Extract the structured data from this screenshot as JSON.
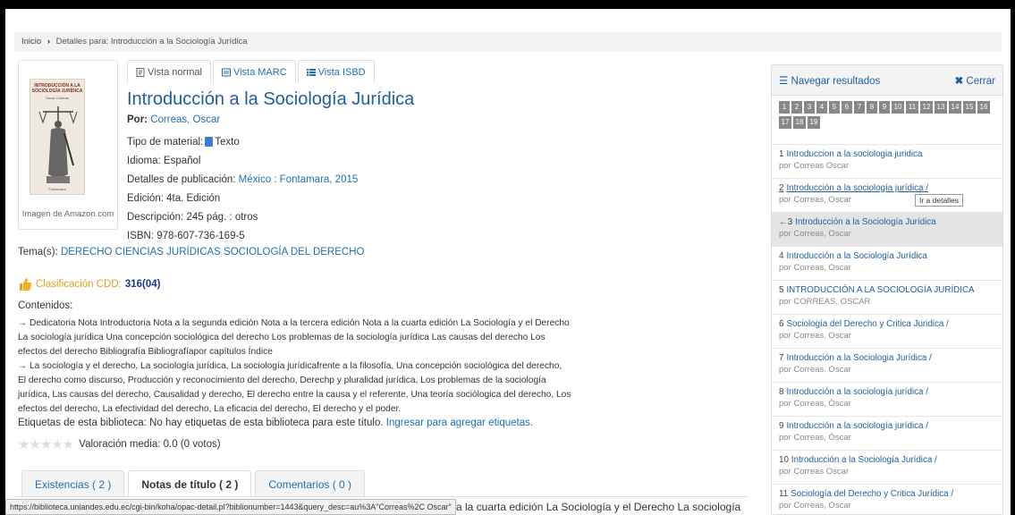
{
  "breadcrumb": {
    "home": "Inicio",
    "current": "Detalles para: Introducción a la Sociología Jurídica"
  },
  "cover": {
    "book_title": "INTRODUCCIÓN A LA SOCIOLOGÍA JURÍDICA",
    "book_author": "Óscar Correas",
    "publisher": "Fontamara",
    "caption": "Imagen de Amazon.com"
  },
  "view_tabs": [
    {
      "label": "Vista normal",
      "icon": "document-icon"
    },
    {
      "label": "Vista MARC",
      "icon": "list-box-icon"
    },
    {
      "label": "Vista ISBD",
      "icon": "list-icon"
    }
  ],
  "record": {
    "title": "Introducción a la Sociología Jurídica",
    "by_label": "Por:",
    "author": "Correas, Oscar",
    "material_label": "Tipo de material:",
    "material_value": "Texto",
    "language": "Idioma: Español",
    "pub_label": "Detalles de publicación:",
    "pub_value": "México : Fontamara, 2015",
    "edition": "Edición: 4ta. Edición",
    "description": "Descripción: 245 pág. : otros",
    "isbn": "ISBN: 978-607-736-169-5"
  },
  "subject": {
    "label": "Tema(s):",
    "value": "DERECHO CIENCIAS JURÍDICAS SOCIOLOGÍA DEL DERECHO"
  },
  "cdd": {
    "label": "Clasificación CDD:",
    "value": "316(04)"
  },
  "contents": {
    "label": "Contenidos:",
    "p1": "→ Dedicatoria Nota Introductoria Nota a la segunda edición Nota a la tercera edición Nota a la cuarta edición La Sociología y el Derecho La sociología jurídica Una concepción sociológica del derecho Los problemas de la sociología jurídica Las causas del derecho Los efectos del derecho Bibliografía Bibliografíapor capítulos Índice",
    "p2": "→ La sociología y el derecho, La sociología jurídica, La sociología jurídicafrente a la filosofía, Una concepción sociológica del derecho, El derecho como discurso, Producción y reconocimiento del derecho, Derechp y pluralidad jurídica, Los problemas de la sociología jurídica, Las causas del derecho, Causalidad y derecho, El derecho entre la causa y el referente, Una teoría sociólogica del derecho, Los efectos del derecho, La efectividad del derecho, La eficacia del derecho, El derecho y el poder."
  },
  "tags": {
    "label": "Etiquetas de esta biblioteca:",
    "text": "No hay etiquetas de esta biblioteca para este título.",
    "link": "Ingresar para agregar etiquetas."
  },
  "rating": {
    "stars": "★★★★★",
    "text": "Valoración media: 0.0 (0 votos)"
  },
  "bottom_tabs": [
    {
      "label": "Existencias ( 2 )"
    },
    {
      "label": "Notas de título ( 2 )"
    },
    {
      "label": "Comentarios ( 0 )"
    }
  ],
  "status_url": "https://biblioteca.uniandes.edu.ec/cgi-bin/koha/opac-detail.pl?biblionumber=1443&query_desc=au%3A\"Correas%2C Oscar\"",
  "below_text": "a la cuarta edición La Sociología y el Derecho La sociología",
  "results_panel": {
    "browse_label": "Navegar resultados",
    "close_label": "Cerrar",
    "pages": [
      "1",
      "2",
      "3",
      "4",
      "5",
      "6",
      "7",
      "8",
      "9",
      "10",
      "11",
      "12",
      "13",
      "14",
      "15",
      "16",
      "17",
      "18",
      "19"
    ],
    "tooltip": "Ir a detalles",
    "items": [
      {
        "num": "1",
        "title": "Introduccion a la sociologia juridica",
        "author": "por Correas Oscar"
      },
      {
        "num": "2",
        "title": "Introducción a la sociología jurídica /",
        "author": "por Correas, Oscar"
      },
      {
        "num": "←3",
        "title": "Introducción a la Sociología Jurídica",
        "author": "por Correas, Oscar"
      },
      {
        "num": "4",
        "title": "Introducción a la Sociología Jurídica",
        "author": "por Correas, Oscar"
      },
      {
        "num": "5",
        "title": "INTRODUCCIÓN A LA SOCIOLOGÍA JURÍDICA",
        "author": "por CORREAS, OSCAR"
      },
      {
        "num": "6",
        "title": "Sociología del Derecho y Critica Juridica /",
        "author": "por Correas. Oscar"
      },
      {
        "num": "7",
        "title": "Introducción a la Sociologia Jurídica /",
        "author": "por Correas. Oscar"
      },
      {
        "num": "8",
        "title": "Introducción a la sociología jurídica /",
        "author": "por Correas, Óscar"
      },
      {
        "num": "9",
        "title": "Introducción a la sociología jurídica /",
        "author": "por Correas, Óscar"
      },
      {
        "num": "10",
        "title": "Introducción a la Sociología Jurídica /",
        "author": "por Correas Oscar"
      },
      {
        "num": "11",
        "title": "Sociología del Derecho y Critica Jurídica /",
        "author": "por Correas, Oscar"
      }
    ]
  },
  "colors": {
    "link": "#1f6fb2",
    "title": "#1f5fa0",
    "cdd_label": "#e0a020",
    "current_row": "#e4e4e4"
  }
}
